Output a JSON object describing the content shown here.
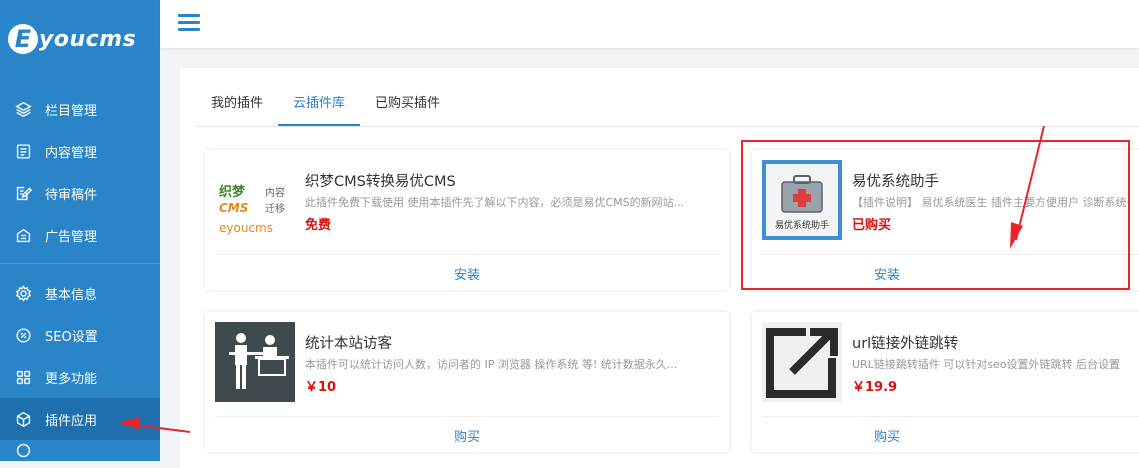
{
  "sidebar": {
    "logo_letter": "E",
    "logo_text": "youcms",
    "items": [
      {
        "label": "栏目管理",
        "icon": "layers-icon"
      },
      {
        "label": "内容管理",
        "icon": "document-list-icon"
      },
      {
        "label": "待审稿件",
        "icon": "edit-document-icon"
      },
      {
        "label": "广告管理",
        "icon": "ad-icon"
      },
      {
        "label": "基本信息",
        "icon": "gear-icon"
      },
      {
        "label": "SEO设置",
        "icon": "seo-icon"
      },
      {
        "label": "更多功能",
        "icon": "grid-icon"
      },
      {
        "label": "插件应用",
        "icon": "cube-icon"
      }
    ],
    "active_index": 7
  },
  "tabs": {
    "items": [
      "我的插件",
      "云插件库",
      "已购买插件"
    ],
    "active_index": 1
  },
  "cards": [
    {
      "title": "织梦CMS转换易优CMS",
      "desc": "此插件免费下载使用 使用本插件先了解以下内容，必须是易优CMS的新网站...",
      "price": "免费",
      "action": "安装",
      "thumb": {
        "line1": "织梦",
        "line1b": "内容",
        "line2": "CMS",
        "line2b": "迁移",
        "line3": "eyoucms"
      }
    },
    {
      "title": "易优系统助手",
      "desc": "【插件说明】 易优系统医生 插件主要方便用户 诊断系统",
      "price": "已购买",
      "action": "安装",
      "thumb": {
        "caption": "易优系统助手"
      }
    },
    {
      "title": "统计本站访客",
      "desc": "本插件可以统计访问人数，访问者的 IP 浏览器 操作系统 等! 统计数据永久...",
      "price": "￥10",
      "action": "购买"
    },
    {
      "title": "url链接外链跳转",
      "desc": "URL链接跳转插件 可以针对seo设置外链跳转 后台设置",
      "price": "￥19.9",
      "action": "购买"
    }
  ],
  "colors": {
    "sidebar_bg": "#2a84c8",
    "accent": "#2a84c8",
    "price_red": "#d9100d",
    "highlight_red": "#e8262a"
  }
}
